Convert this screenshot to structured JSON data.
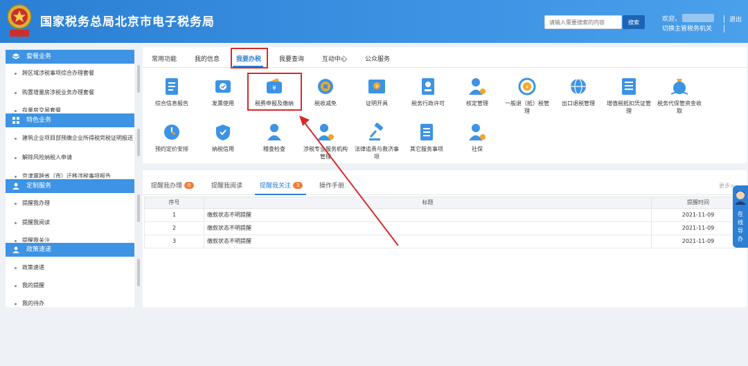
{
  "header": {
    "title": "国家税务总局北京市电子税务局",
    "search_placeholder": "请输入需要搜索的内容",
    "search_button": "搜索",
    "welcome": "欢迎，",
    "switch_org": "切换主管税务机关",
    "logout": "退出",
    "emblem_text": "中国税务"
  },
  "sidebar": {
    "sections": [
      {
        "title": "套餐业务",
        "icon": "package-icon",
        "items": [
          "跨区域涉税事项综合办理套餐",
          "购置增量房涉税业务办理套餐",
          "存量房交易套餐"
        ]
      },
      {
        "title": "特色业务",
        "icon": "grid-icon",
        "items": [
          "建筑企业项目部预缴企业所得税完税证明报送",
          "解除风险纳税人申请",
          "京津冀跨省（市）迁移涉税事项报告"
        ]
      },
      {
        "title": "定制服务",
        "icon": "user-icon",
        "items": [
          "提醒我办理",
          "提醒我阅读",
          "提醒我关注"
        ]
      },
      {
        "title": "政策速递",
        "icon": "user-icon",
        "items": [
          "政策速递",
          "我的提醒",
          "我的待办"
        ]
      }
    ]
  },
  "tabs": [
    "常用功能",
    "我的信息",
    "我要办税",
    "我要查询",
    "互动中心",
    "公众服务"
  ],
  "active_tab": "我要办税",
  "functions_row1": [
    {
      "label": "综合信息报告",
      "icon": "document-icon"
    },
    {
      "label": "发票使用",
      "icon": "ticket-icon"
    },
    {
      "label": "税费申报及缴纳",
      "icon": "wallet-icon"
    },
    {
      "label": "税收减免",
      "icon": "coin-icon"
    },
    {
      "label": "证明开具",
      "icon": "certificate-icon"
    },
    {
      "label": "税务行政许可",
      "icon": "badge-icon"
    },
    {
      "label": "核定管理",
      "icon": "person-gear-icon"
    },
    {
      "label": "一般退（抵）税管理",
      "icon": "refund-icon"
    },
    {
      "label": "出口退税管理",
      "icon": "globe-icon"
    },
    {
      "label": "增值税抵扣凭证管理",
      "icon": "receipt-icon"
    },
    {
      "label": "税务代保管资金收取",
      "icon": "money-bag-icon"
    }
  ],
  "functions_row2": [
    {
      "label": "预约定价安排",
      "icon": "clock-icon"
    },
    {
      "label": "纳税信用",
      "icon": "heart-shield-icon"
    },
    {
      "label": "稽查检查",
      "icon": "person-icon"
    },
    {
      "label": "涉税专业服务机构管理",
      "icon": "person-gear-icon"
    },
    {
      "label": "法律追责与救济事项",
      "icon": "gavel-icon"
    },
    {
      "label": "其它服务事项",
      "icon": "list-icon"
    },
    {
      "label": "社保",
      "icon": "person-gear-icon"
    }
  ],
  "bottom_tabs": [
    {
      "label": "提醒我办理",
      "badge": "0"
    },
    {
      "label": "提醒我阅读",
      "badge": ""
    },
    {
      "label": "提醒我关注",
      "badge": "3"
    },
    {
      "label": "操作手册",
      "badge": ""
    }
  ],
  "more": "更多>",
  "table": {
    "headers": [
      "序号",
      "标题",
      "提醒时间"
    ],
    "rows": [
      [
        "1",
        "缴款状态不明提醒",
        "2021-11-09"
      ],
      [
        "2",
        "缴款状态不明提醒",
        "2021-11-09"
      ],
      [
        "3",
        "缴款状态不明提醒",
        "2021-11-09"
      ]
    ]
  },
  "guide": {
    "text": "在线导办"
  },
  "colors": {
    "primary": "#2b7fd4",
    "header": "#3d93e4",
    "highlight": "#d62a2a",
    "badge": "#f07d3a"
  }
}
